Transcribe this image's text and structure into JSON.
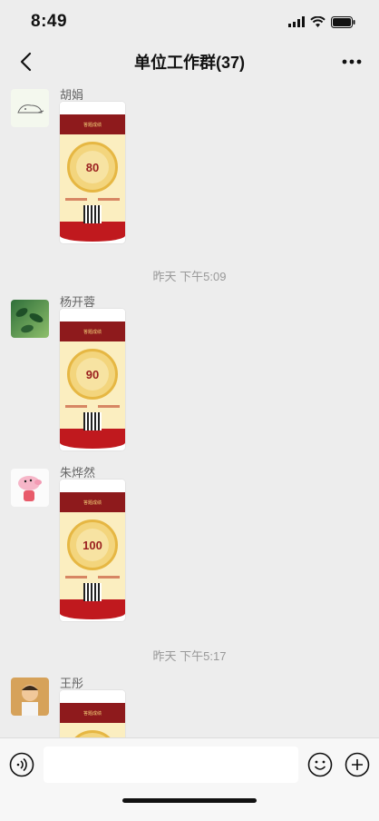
{
  "status": {
    "time": "8:49"
  },
  "header": {
    "title": "单位工作群(37)"
  },
  "messages": [
    {
      "sender": "胡娟",
      "score": "80",
      "banner": "答题成绩"
    },
    {
      "sender": "杨开蓉",
      "score": "90",
      "banner": "答题成绩"
    },
    {
      "sender": "朱烨然",
      "score": "100",
      "banner": "答题成绩"
    },
    {
      "sender": "王彤",
      "score": "",
      "banner": "答题成绩"
    }
  ],
  "time_separators": [
    "昨天 下午5:09",
    "昨天 下午5:17"
  ],
  "input": {
    "placeholder": ""
  },
  "colors": {
    "background": "#ededed",
    "card_red": "#8e1a1c",
    "gold": "#f3d57d"
  }
}
